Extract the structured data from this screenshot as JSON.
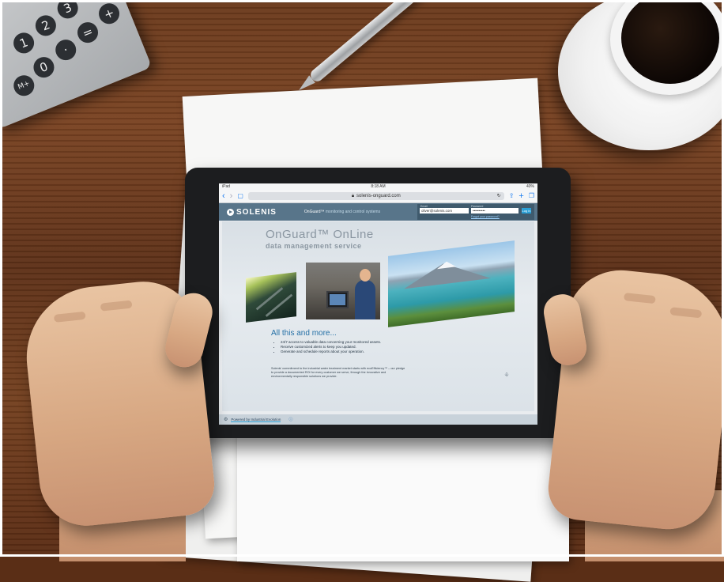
{
  "calculator": {
    "keys": [
      "1",
      "2",
      "3",
      "4",
      "0",
      "·",
      "=",
      "+",
      "M+"
    ]
  },
  "tablet": {
    "status": {
      "left": "iPad",
      "time": "8:18 AM",
      "right": "40%"
    },
    "browser": {
      "url": "solenis-onguard.com"
    },
    "site": {
      "logo": "SOLENIS",
      "tagline_main": "OnGuard™",
      "tagline_rest": "monitoring and control systems",
      "login": {
        "email_label": "Email",
        "password_label": "Password",
        "email_value": "oliver@solenis.com",
        "password_value": "••••••••••",
        "go_label": "Log in",
        "forgot": "Forgot your password?"
      },
      "hero_title": "OnGuard™ OnLine",
      "hero_subtitle": "data management service",
      "more_title": "All this and more...",
      "bullets": [
        "24/7 access to valuable data concerning your monitored assets.",
        "Receive customized alerts to keep you updated.",
        "Generate and schedule reports about your operation."
      ],
      "blurb": "Solenis' commitment to the industrial water treatment market starts with ecoEfficiency™ – our pledge to provide a documented ROI for every customer we serve, through the innovative and environmentally responsible solutions we provide.",
      "footer": "Powered by Industrial Evolution"
    }
  }
}
